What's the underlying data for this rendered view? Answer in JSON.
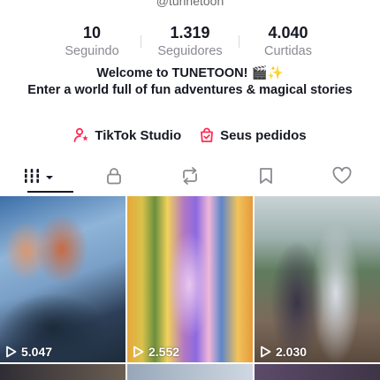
{
  "profile": {
    "handle": "@tunnetoon",
    "stats": [
      {
        "value": "10",
        "label": "Seguindo"
      },
      {
        "value": "1.319",
        "label": "Seguidores"
      },
      {
        "value": "4.040",
        "label": "Curtidas"
      }
    ],
    "bio": {
      "line1": "Welcome to TUNETOON! 🎬✨",
      "line2": "Enter a world full of fun adventures & magical stories"
    },
    "links": {
      "studio": "TikTok Studio",
      "orders": "Seus pedidos"
    }
  },
  "tabs": [
    {
      "name": "videos-grid",
      "icon": "grid-icon"
    },
    {
      "name": "private",
      "icon": "lock-icon"
    },
    {
      "name": "reposts",
      "icon": "repost-icon"
    },
    {
      "name": "favorites",
      "icon": "bookmark-icon"
    },
    {
      "name": "liked",
      "icon": "heart-icon"
    }
  ],
  "videos": [
    {
      "views": "5.047"
    },
    {
      "views": "2.552"
    },
    {
      "views": "2.030"
    }
  ],
  "colors": {
    "text": "#161823",
    "muted": "#8a8b91",
    "accent": "#fe2c55"
  }
}
